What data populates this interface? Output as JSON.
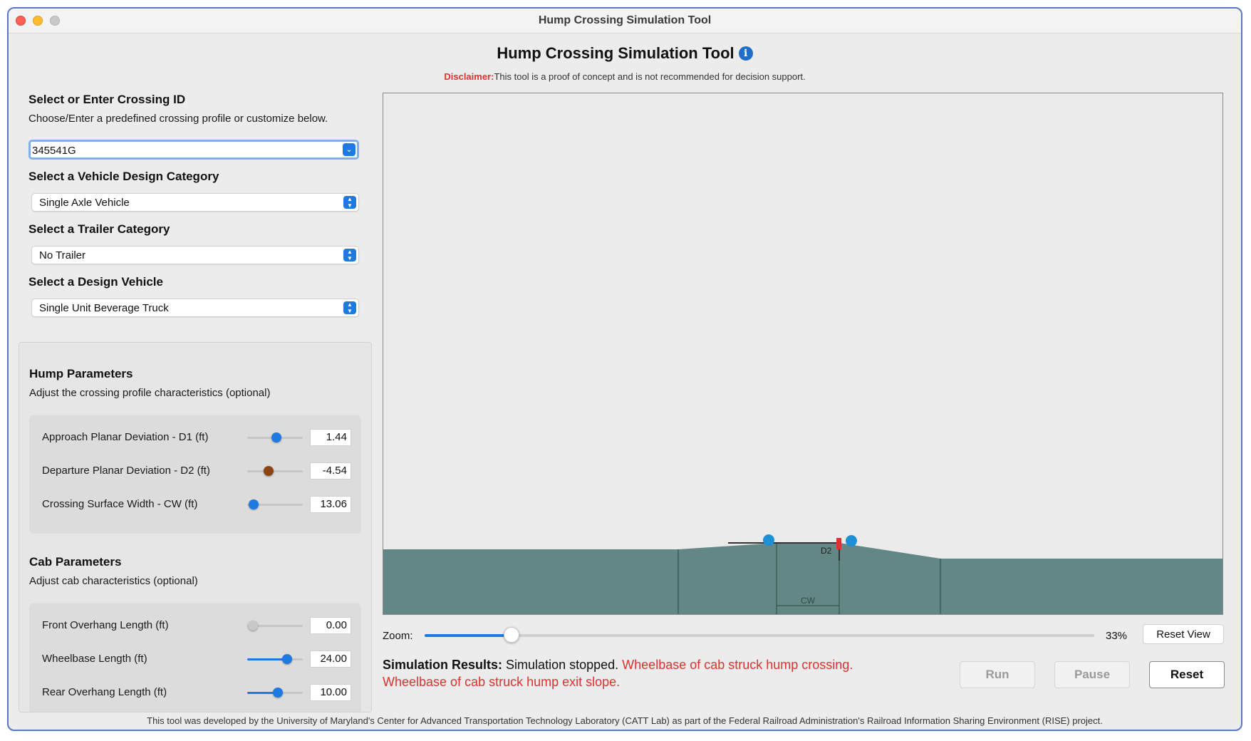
{
  "window": {
    "title": "Hump Crossing Simulation Tool"
  },
  "header": {
    "title": "Hump Crossing Simulation Tool",
    "info_icon": "i",
    "disclaimer_label": "Disclaimer:",
    "disclaimer_text": "This tool is a proof of concept and is not recommended for decision support."
  },
  "crossing": {
    "title": "Select or Enter Crossing ID",
    "description": "Choose/Enter a predefined crossing profile or customize below.",
    "value": "345541G"
  },
  "vehicle_category": {
    "title": "Select a Vehicle Design Category",
    "value": "Single Axle Vehicle"
  },
  "trailer_category": {
    "title": "Select a Trailer Category",
    "value": "No Trailer"
  },
  "design_vehicle": {
    "title": "Select a Design Vehicle",
    "value": "Single Unit Beverage Truck"
  },
  "hump_params": {
    "title": "Hump Parameters",
    "description": "Adjust the crossing profile characteristics (optional)",
    "items": [
      {
        "label": "Approach Planar Deviation - D1 (ft)",
        "value": "1.44",
        "slider_fraction": 0.52,
        "knob_color": "#1f7ae0",
        "fill": false
      },
      {
        "label": "Departure Planar Deviation - D2 (ft)",
        "value": "-4.54",
        "slider_fraction": 0.38,
        "knob_color": "#8b4513",
        "fill": false
      },
      {
        "label": "Crossing Surface Width - CW (ft)",
        "value": "13.06",
        "slider_fraction": 0.12,
        "knob_color": "#1f7ae0",
        "fill": false
      }
    ]
  },
  "cab_params": {
    "title": "Cab Parameters",
    "description": "Adjust cab characteristics (optional)",
    "items": [
      {
        "label": "Front Overhang Length (ft)",
        "value": "0.00",
        "slider_fraction": 0.1,
        "knob_color": "#c8c8c8",
        "fill": false
      },
      {
        "label": "Wheelbase Length (ft)",
        "value": "24.00",
        "slider_fraction": 0.72,
        "knob_color": "#1f7ae0",
        "fill": true
      },
      {
        "label": "Rear Overhang Length (ft)",
        "value": "10.00",
        "slider_fraction": 0.55,
        "knob_color": "#1f7ae0",
        "fill": true
      }
    ]
  },
  "canvas": {
    "d2_label": "D2",
    "cw_label": "CW",
    "ground_color": "#628784",
    "wheel_color": "#1f8fd6",
    "marker_color": "#e03131"
  },
  "zoom": {
    "label": "Zoom:",
    "value": "33%",
    "fraction": 0.13,
    "reset_label": "Reset View"
  },
  "results": {
    "label": "Simulation Results:",
    "status": "Simulation stopped.",
    "error1": "Wheelbase of cab struck hump crossing.",
    "error2": "Wheelbase of cab struck hump exit slope."
  },
  "buttons": {
    "run": "Run",
    "pause": "Pause",
    "reset": "Reset"
  },
  "footer": "This tool was developed by the University of Maryland's Center for Advanced Transportation Technology Laboratory (CATT Lab) as part of the Federal Railroad Administration's Railroad Information Sharing Environment (RISE) project."
}
